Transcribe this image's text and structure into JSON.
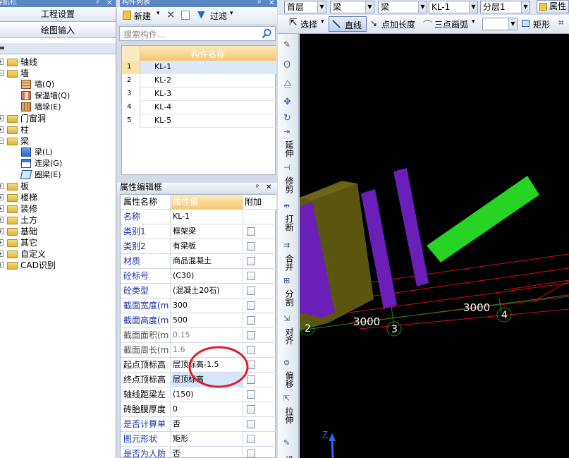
{
  "left_panel": {
    "title": "导航栏",
    "close_symbol": "✕",
    "pin_symbol": "ᵖ",
    "buttons": [
      "工程设置",
      "绘图输入"
    ],
    "tree": [
      {
        "label": "轴线",
        "icon": "folder-icon",
        "expanded": false
      },
      {
        "label": "墙",
        "icon": "folder-open-icon",
        "expanded": true,
        "children": [
          {
            "label": "墙(Q)",
            "icon": "wall-icon"
          },
          {
            "label": "保温墙(Q)",
            "icon": "insulation-wall-icon"
          },
          {
            "label": "墙垛(E)",
            "icon": "wall-pier-icon"
          }
        ]
      },
      {
        "label": "门窗洞",
        "icon": "folder-icon",
        "expanded": false
      },
      {
        "label": "柱",
        "icon": "folder-icon",
        "expanded": false
      },
      {
        "label": "梁",
        "icon": "folder-open-icon",
        "expanded": true,
        "children": [
          {
            "label": "梁(L)",
            "icon": "beam-icon"
          },
          {
            "label": "连梁(G)",
            "icon": "link-beam-icon"
          },
          {
            "label": "圈梁(E)",
            "icon": "ring-beam-icon"
          }
        ]
      },
      {
        "label": "板",
        "icon": "folder-icon",
        "expanded": false
      },
      {
        "label": "楼梯",
        "icon": "folder-icon",
        "expanded": false
      },
      {
        "label": "装修",
        "icon": "folder-icon",
        "expanded": false
      },
      {
        "label": "土方",
        "icon": "folder-icon",
        "expanded": false
      },
      {
        "label": "基础",
        "icon": "folder-icon",
        "expanded": false
      },
      {
        "label": "其它",
        "icon": "folder-icon",
        "expanded": false
      },
      {
        "label": "自定义",
        "icon": "folder-icon",
        "expanded": false
      },
      {
        "label": "CAD识别",
        "icon": "folder-icon",
        "expanded": false
      }
    ]
  },
  "component_list": {
    "title": "构件列表",
    "new_label": "新建",
    "filter_label": "过滤",
    "search_placeholder": "搜索构件...",
    "column_header": "构件名称",
    "rows": [
      {
        "num": "1",
        "name": "KL-1"
      },
      {
        "num": "2",
        "name": "KL-2"
      },
      {
        "num": "3",
        "name": "KL-3"
      },
      {
        "num": "4",
        "name": "KL-4"
      },
      {
        "num": "5",
        "name": "KL-5"
      }
    ]
  },
  "property_editor": {
    "title": "属性编辑框",
    "headers": {
      "name": "属性名称",
      "value": "属性值",
      "extra": "附加"
    },
    "rows": [
      {
        "name": "名称",
        "value": "KL-1",
        "blue": true,
        "grey": false,
        "check": false
      },
      {
        "name": "类别1",
        "value": "框架梁",
        "blue": true,
        "grey": false,
        "check": true
      },
      {
        "name": "类别2",
        "value": "有梁板",
        "blue": true,
        "grey": false,
        "check": true
      },
      {
        "name": "材质",
        "value": "商品混凝土",
        "blue": true,
        "grey": false,
        "check": true
      },
      {
        "name": "砼标号",
        "value": "(C30)",
        "blue": true,
        "grey": false,
        "check": true
      },
      {
        "name": "砼类型",
        "value": "(混凝土20石)",
        "blue": true,
        "grey": false,
        "check": true
      },
      {
        "name": "截面宽度(m",
        "value": "300",
        "blue": true,
        "grey": false,
        "check": true
      },
      {
        "name": "截面高度(m",
        "value": "500",
        "blue": true,
        "grey": false,
        "check": true
      },
      {
        "name": "截面面积(m",
        "value": "0.15",
        "blue": false,
        "grey": true,
        "check": true
      },
      {
        "name": "截面周长(m",
        "value": "1.6",
        "blue": false,
        "grey": true,
        "check": true
      },
      {
        "name": "起点顶标高",
        "value": "层顶标高-1.5",
        "blue": false,
        "grey": false,
        "check": true
      },
      {
        "name": "终点顶标高",
        "value": "层顶标高",
        "blue": false,
        "grey": false,
        "check": true,
        "selected": true
      },
      {
        "name": "轴线距梁左",
        "value": "(150)",
        "blue": false,
        "grey": false,
        "check": true
      },
      {
        "name": "砖胎膜厚度",
        "value": "0",
        "blue": false,
        "grey": false,
        "check": true
      },
      {
        "name": "是否计算单",
        "value": "否",
        "blue": true,
        "grey": false,
        "check": true
      },
      {
        "name": "图元形状",
        "value": "矩形",
        "blue": true,
        "grey": false,
        "check": true
      },
      {
        "name": "是否为人防",
        "value": "否",
        "blue": true,
        "grey": false,
        "check": true
      }
    ]
  },
  "toolbar_top": {
    "floor": "首层",
    "type1": "梁",
    "type2": "梁",
    "component": "KL-1",
    "layer": "分层1",
    "last_button": "属性"
  },
  "toolbar_draw": {
    "select_label": "选择",
    "line_label": "直线",
    "add_length_label": "点加长度",
    "arc_label": "三点画弧",
    "rect_label": "矩形"
  },
  "vertical_toolbar": [
    "延伸",
    "修剪",
    "打断",
    "合并",
    "分割",
    "对齐",
    "偏移",
    "拉伸",
    "设"
  ],
  "viewport": {
    "axis_numbers": [
      "2",
      "3",
      "4"
    ],
    "dimensions": [
      "3000",
      "3000"
    ],
    "z_axis_label": "Z",
    "colors": {
      "background": "#000000",
      "purple": "#6a1fb8",
      "green": "#27d323",
      "red_grid": "#d01010",
      "axis_green": "#1d8a1d",
      "wall": "#5a560f"
    }
  },
  "annotation": {
    "color": "#e01a2c"
  }
}
